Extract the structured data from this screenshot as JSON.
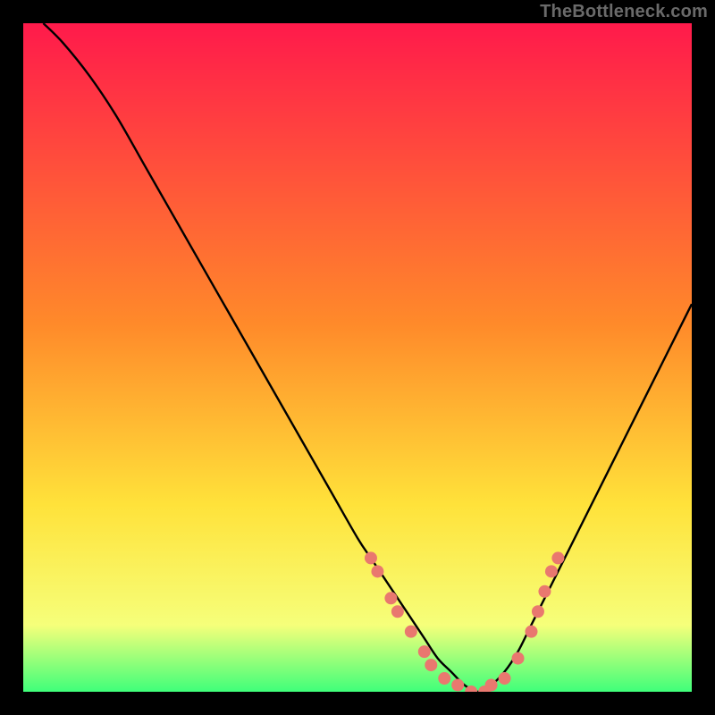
{
  "watermark": "TheBottleneck.com",
  "colors": {
    "gradient_top": "#ff1a4b",
    "gradient_mid1": "#ff8a2a",
    "gradient_mid2": "#ffe23a",
    "gradient_bot1": "#f6ff7a",
    "gradient_bot2": "#3fff7a",
    "curve": "#000000",
    "marker_fill": "#e9786f",
    "marker_stroke": "#e9786f"
  },
  "chart_data": {
    "type": "line",
    "title": "",
    "xlabel": "",
    "ylabel": "",
    "xlim": [
      0,
      100
    ],
    "ylim": [
      0,
      100
    ],
    "legend": false,
    "grid": false,
    "series": [
      {
        "name": "bottleneck-curve",
        "x": [
          3,
          6,
          10,
          14,
          18,
          22,
          26,
          30,
          34,
          38,
          42,
          46,
          50,
          52,
          54,
          56,
          58,
          60,
          62,
          64,
          66,
          68,
          70,
          72,
          74,
          76,
          80,
          84,
          88,
          92,
          96,
          100
        ],
        "y": [
          100,
          97,
          92,
          86,
          79,
          72,
          65,
          58,
          51,
          44,
          37,
          30,
          23,
          20,
          17,
          14,
          11,
          8,
          5,
          3,
          1,
          0,
          1,
          3,
          6,
          10,
          18,
          26,
          34,
          42,
          50,
          58
        ]
      }
    ],
    "markers": [
      {
        "x": 52,
        "y": 20
      },
      {
        "x": 53,
        "y": 18
      },
      {
        "x": 55,
        "y": 14
      },
      {
        "x": 56,
        "y": 12
      },
      {
        "x": 58,
        "y": 9
      },
      {
        "x": 60,
        "y": 6
      },
      {
        "x": 61,
        "y": 4
      },
      {
        "x": 63,
        "y": 2
      },
      {
        "x": 65,
        "y": 1
      },
      {
        "x": 67,
        "y": 0
      },
      {
        "x": 69,
        "y": 0
      },
      {
        "x": 70,
        "y": 1
      },
      {
        "x": 72,
        "y": 2
      },
      {
        "x": 74,
        "y": 5
      },
      {
        "x": 76,
        "y": 9
      },
      {
        "x": 77,
        "y": 12
      },
      {
        "x": 78,
        "y": 15
      },
      {
        "x": 79,
        "y": 18
      },
      {
        "x": 80,
        "y": 20
      }
    ]
  }
}
